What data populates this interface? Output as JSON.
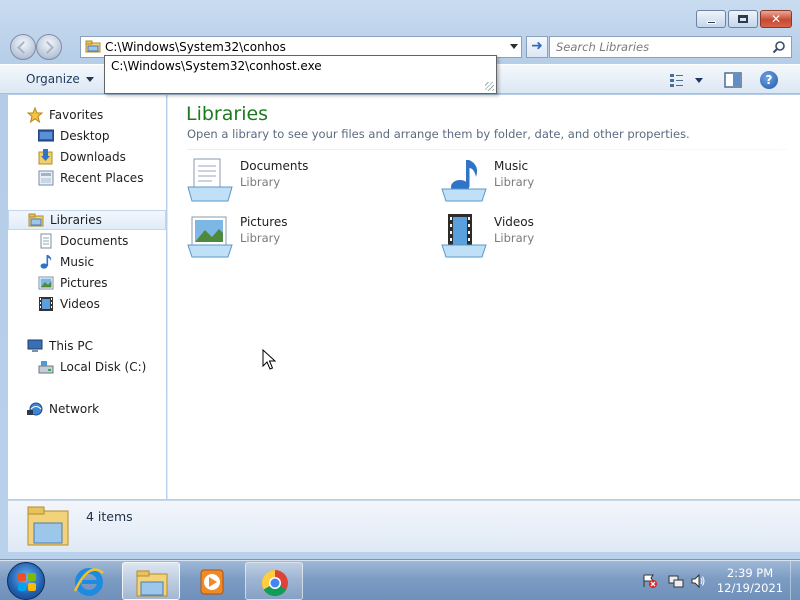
{
  "window": {
    "caption_buttons": {
      "minimize": "minimize",
      "maximize": "maximize",
      "close": "close"
    }
  },
  "navigation": {
    "address_value": "C:\\Windows\\System32\\conhos",
    "go_icon": "arrow-right-icon",
    "search_placeholder": "Search Libraries",
    "autocomplete_suggestion": "C:\\Windows\\System32\\conhost.exe"
  },
  "toolbar": {
    "organize_label": "Organize",
    "help_label": "?"
  },
  "sidebar": {
    "favorites": {
      "label": "Favorites",
      "items": [
        {
          "label": "Desktop",
          "icon": "desktop-icon"
        },
        {
          "label": "Downloads",
          "icon": "downloads-icon"
        },
        {
          "label": "Recent Places",
          "icon": "recent-places-icon"
        }
      ]
    },
    "libraries": {
      "label": "Libraries",
      "selected": true,
      "items": [
        {
          "label": "Documents",
          "icon": "documents-icon"
        },
        {
          "label": "Music",
          "icon": "music-icon"
        },
        {
          "label": "Pictures",
          "icon": "pictures-icon"
        },
        {
          "label": "Videos",
          "icon": "videos-icon"
        }
      ]
    },
    "this_pc": {
      "label": "This PC",
      "items": [
        {
          "label": "Local Disk (C:)",
          "icon": "local-disk-icon"
        }
      ]
    },
    "network": {
      "label": "Network"
    }
  },
  "main": {
    "title": "Libraries",
    "subtitle": "Open a library to see your files and arrange them by folder, date, and other properties.",
    "libraries": [
      {
        "name": "Documents",
        "kind": "Library",
        "icon": "documents-library-icon"
      },
      {
        "name": "Music",
        "kind": "Library",
        "icon": "music-library-icon"
      },
      {
        "name": "Pictures",
        "kind": "Library",
        "icon": "pictures-library-icon"
      },
      {
        "name": "Videos",
        "kind": "Library",
        "icon": "videos-library-icon"
      }
    ]
  },
  "details": {
    "item_count": "4 items"
  },
  "taskbar": {
    "apps": [
      {
        "name": "Internet Explorer",
        "icon": "internet-explorer-icon",
        "state": "pinned"
      },
      {
        "name": "Windows Explorer",
        "icon": "file-explorer-icon",
        "state": "active"
      },
      {
        "name": "Windows Media Player",
        "icon": "media-player-icon",
        "state": "pinned"
      },
      {
        "name": "Google Chrome",
        "icon": "chrome-icon",
        "state": "running"
      }
    ],
    "clock_time": "2:39 PM",
    "clock_date": "12/19/2021"
  },
  "colors": {
    "title_green": "#1e7a1e",
    "taskbar": "#7d9cc3",
    "selection": "#e1ecf9"
  }
}
